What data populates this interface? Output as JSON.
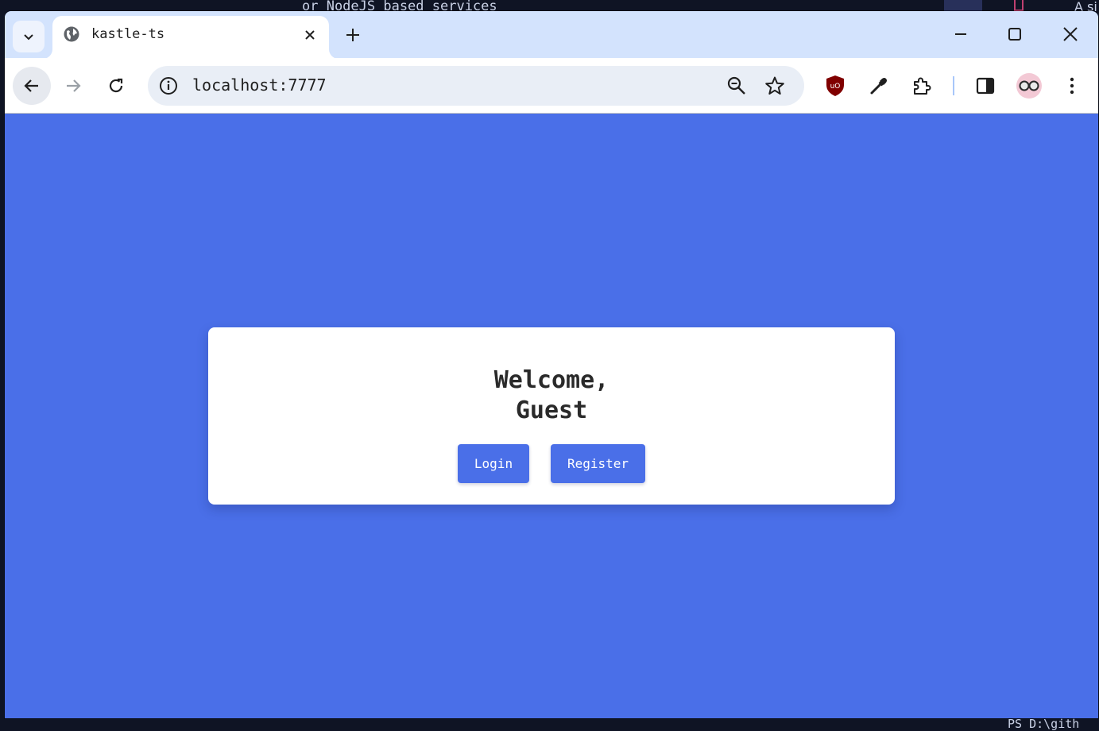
{
  "background": {
    "editor_line": "or NodeJS based services",
    "corner_text": "A si",
    "terminal_prompt": "PS D:\\gith"
  },
  "browser": {
    "tab": {
      "title": "kastle-ts",
      "favicon": "globe-icon"
    },
    "address_bar": {
      "url": "localhost:7777"
    },
    "extensions": [
      "ublock-origin-icon",
      "eyedropper-icon",
      "puzzle-extensions-icon",
      "side-panel-icon"
    ],
    "profile": "glasses-avatar"
  },
  "page": {
    "background_color": "#4a6fe8",
    "welcome_line1": "Welcome,",
    "welcome_line2": "Guest",
    "login_label": "Login",
    "register_label": "Register"
  }
}
